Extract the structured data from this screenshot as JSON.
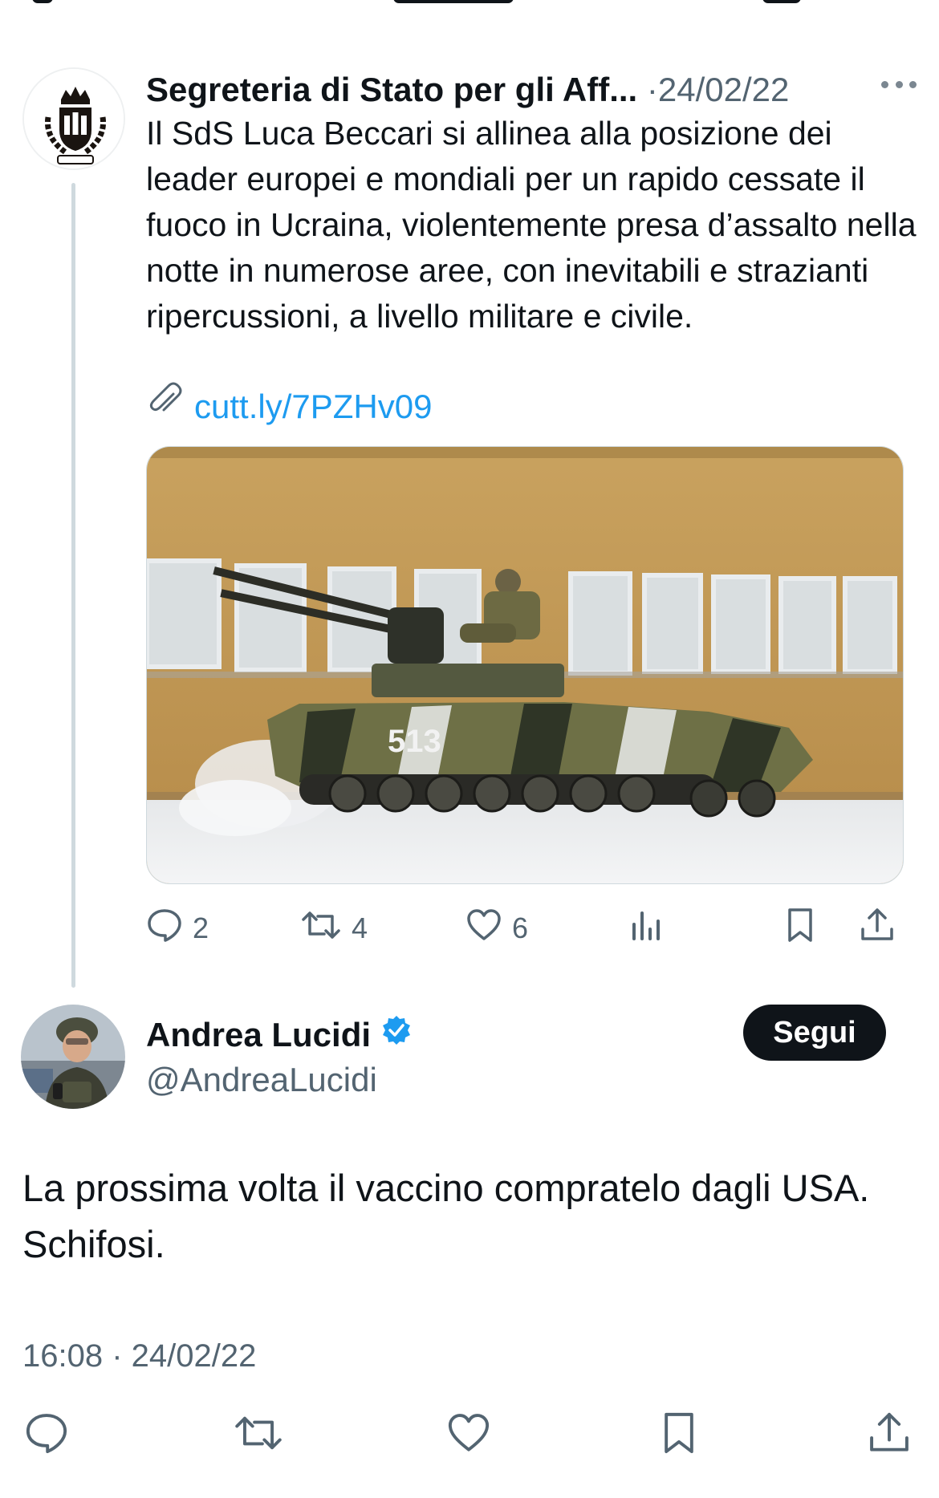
{
  "colors": {
    "text": "#0f1419",
    "secondary": "#536471",
    "link": "#1d9bf0",
    "verified": "#1d9bf0",
    "thread_line": "#cfd9de",
    "follow_button": "#0f1419"
  },
  "tweet1": {
    "author_name": "Segreteria di Stato per gli Aff...",
    "separator": "·",
    "date": "24/02/22",
    "text": "Il SdS Luca Beccari si allinea alla posizione dei leader europei e mondiali per un rapido cessate il fuoco in Ucraina, violentemente presa d’assalto nella notte in numerose aree, con inevitabili e strazianti ripercussioni, a livello militare e civile.",
    "link_icon": "paperclip-icon",
    "link": "cutt.ly/7PZHv09",
    "media": {
      "vehicle_number": "513"
    },
    "actions": {
      "replies": "2",
      "retweets": "4",
      "likes": "6"
    }
  },
  "tweet2": {
    "author_name": "Andrea Lucidi",
    "handle": "@AndreaLucidi",
    "verified": true,
    "follow_label": "Segui",
    "text": "La prossima volta il vaccino compratelo dagli USA. Schifosi.",
    "timestamp": "16:08 · 24/02/22"
  }
}
